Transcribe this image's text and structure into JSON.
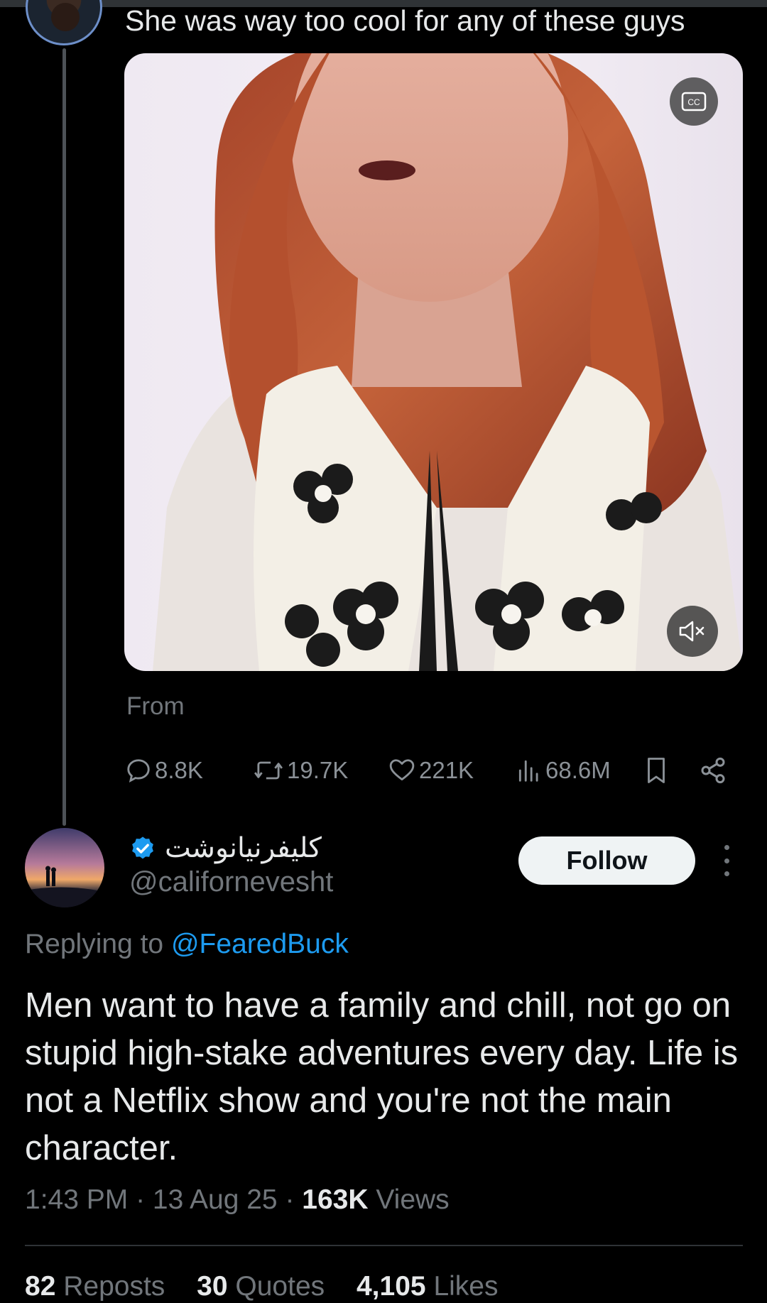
{
  "prev_tweet": {
    "text": "She was way too cool for any of these guys",
    "media_source_label": "From",
    "actions": {
      "replies": "8.8K",
      "reposts": "19.7K",
      "likes": "221K",
      "views": "68.6M"
    }
  },
  "reply_tweet": {
    "display_name": "کلیفرنیانوشت",
    "handle": "@californevesht",
    "follow_label": "Follow",
    "replying_prefix": "Replying to",
    "replying_mention": "@FearedBuck",
    "text": "Men want to have a family and chill, not go on stupid high-stake adventures every day. Life is not a Netflix show and you're not the main character.",
    "time": "1:43 PM",
    "date": "13 Aug 25",
    "views_count": "163K",
    "views_label": "Views",
    "reposts_count": "82",
    "reposts_label": "Reposts",
    "quotes_count": "30",
    "quotes_label": "Quotes",
    "likes_count": "4,105",
    "likes_label": "Likes"
  },
  "colors": {
    "background": "#000000",
    "text": "#e7e9ea",
    "muted": "#71767b",
    "accent": "#1d9bf0",
    "verified": "#1d9bf0"
  },
  "icons": [
    "cc-icon",
    "mute-icon",
    "reply-icon",
    "repost-icon",
    "like-icon",
    "views-icon",
    "bookmark-icon",
    "share-icon",
    "verified-icon",
    "more-icon"
  ]
}
